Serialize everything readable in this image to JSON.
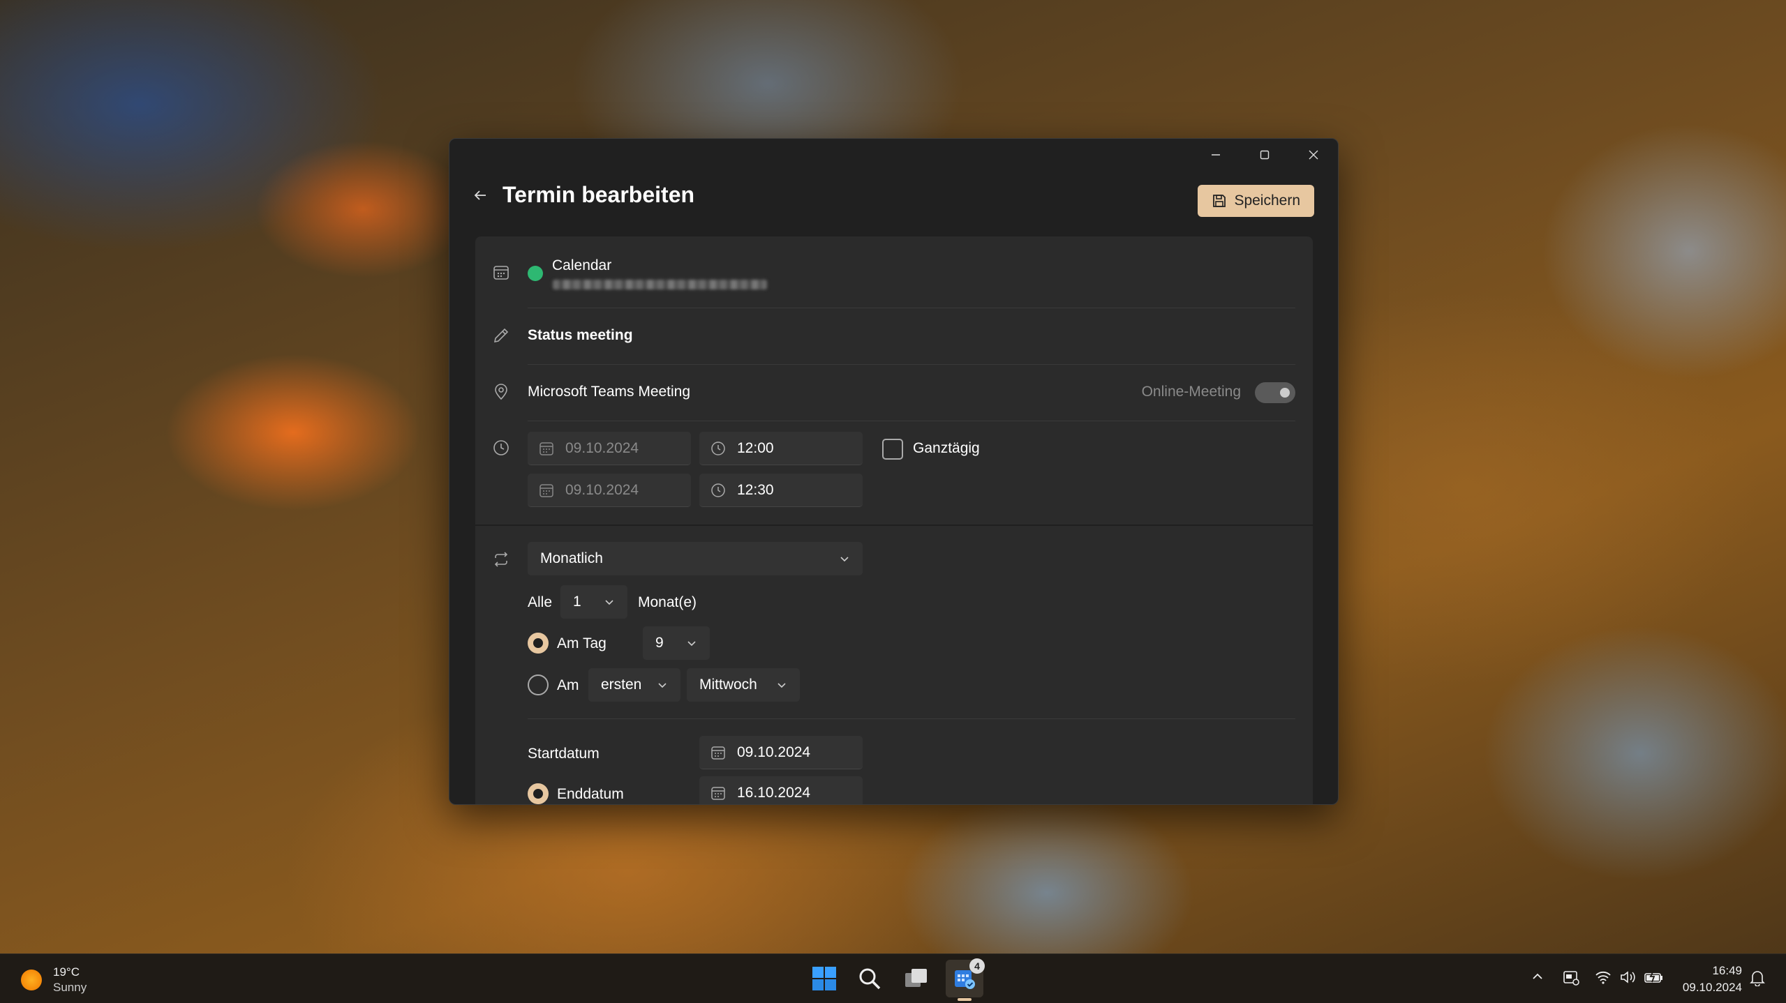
{
  "window": {
    "title": "Termin bearbeiten",
    "save_label": "Speichern"
  },
  "calendar": {
    "name": "Calendar",
    "color": "#2eb872"
  },
  "event": {
    "title": "Status meeting",
    "location": "Microsoft Teams Meeting",
    "online_meeting_label": "Online-Meeting",
    "online_meeting_on": true,
    "start_date": "09.10.2024",
    "start_time": "12:00",
    "end_date": "09.10.2024",
    "end_time": "12:30",
    "all_day_label": "Ganztägig",
    "all_day_checked": false
  },
  "recurrence": {
    "pattern": "Monatlich",
    "every_label": "Alle",
    "every_value": "1",
    "unit_label": "Monat(e)",
    "on_day_label": "Am Tag",
    "on_day_value": "9",
    "on_day_selected": true,
    "on_the_label": "Am",
    "ordinal_value": "ersten",
    "weekday_value": "Mittwoch",
    "start_label": "Startdatum",
    "start_value": "09.10.2024",
    "end_label": "Enddatum",
    "end_value": "16.10.2024",
    "end_selected": true
  },
  "taskbar": {
    "weather_temp": "19°C",
    "weather_desc": "Sunny",
    "badge_count": "4",
    "time": "16:49",
    "date": "09.10.2024"
  },
  "colors": {
    "accent": "#e7c7a0",
    "window_bg": "#202020",
    "panel_bg": "#2b2b2b"
  }
}
